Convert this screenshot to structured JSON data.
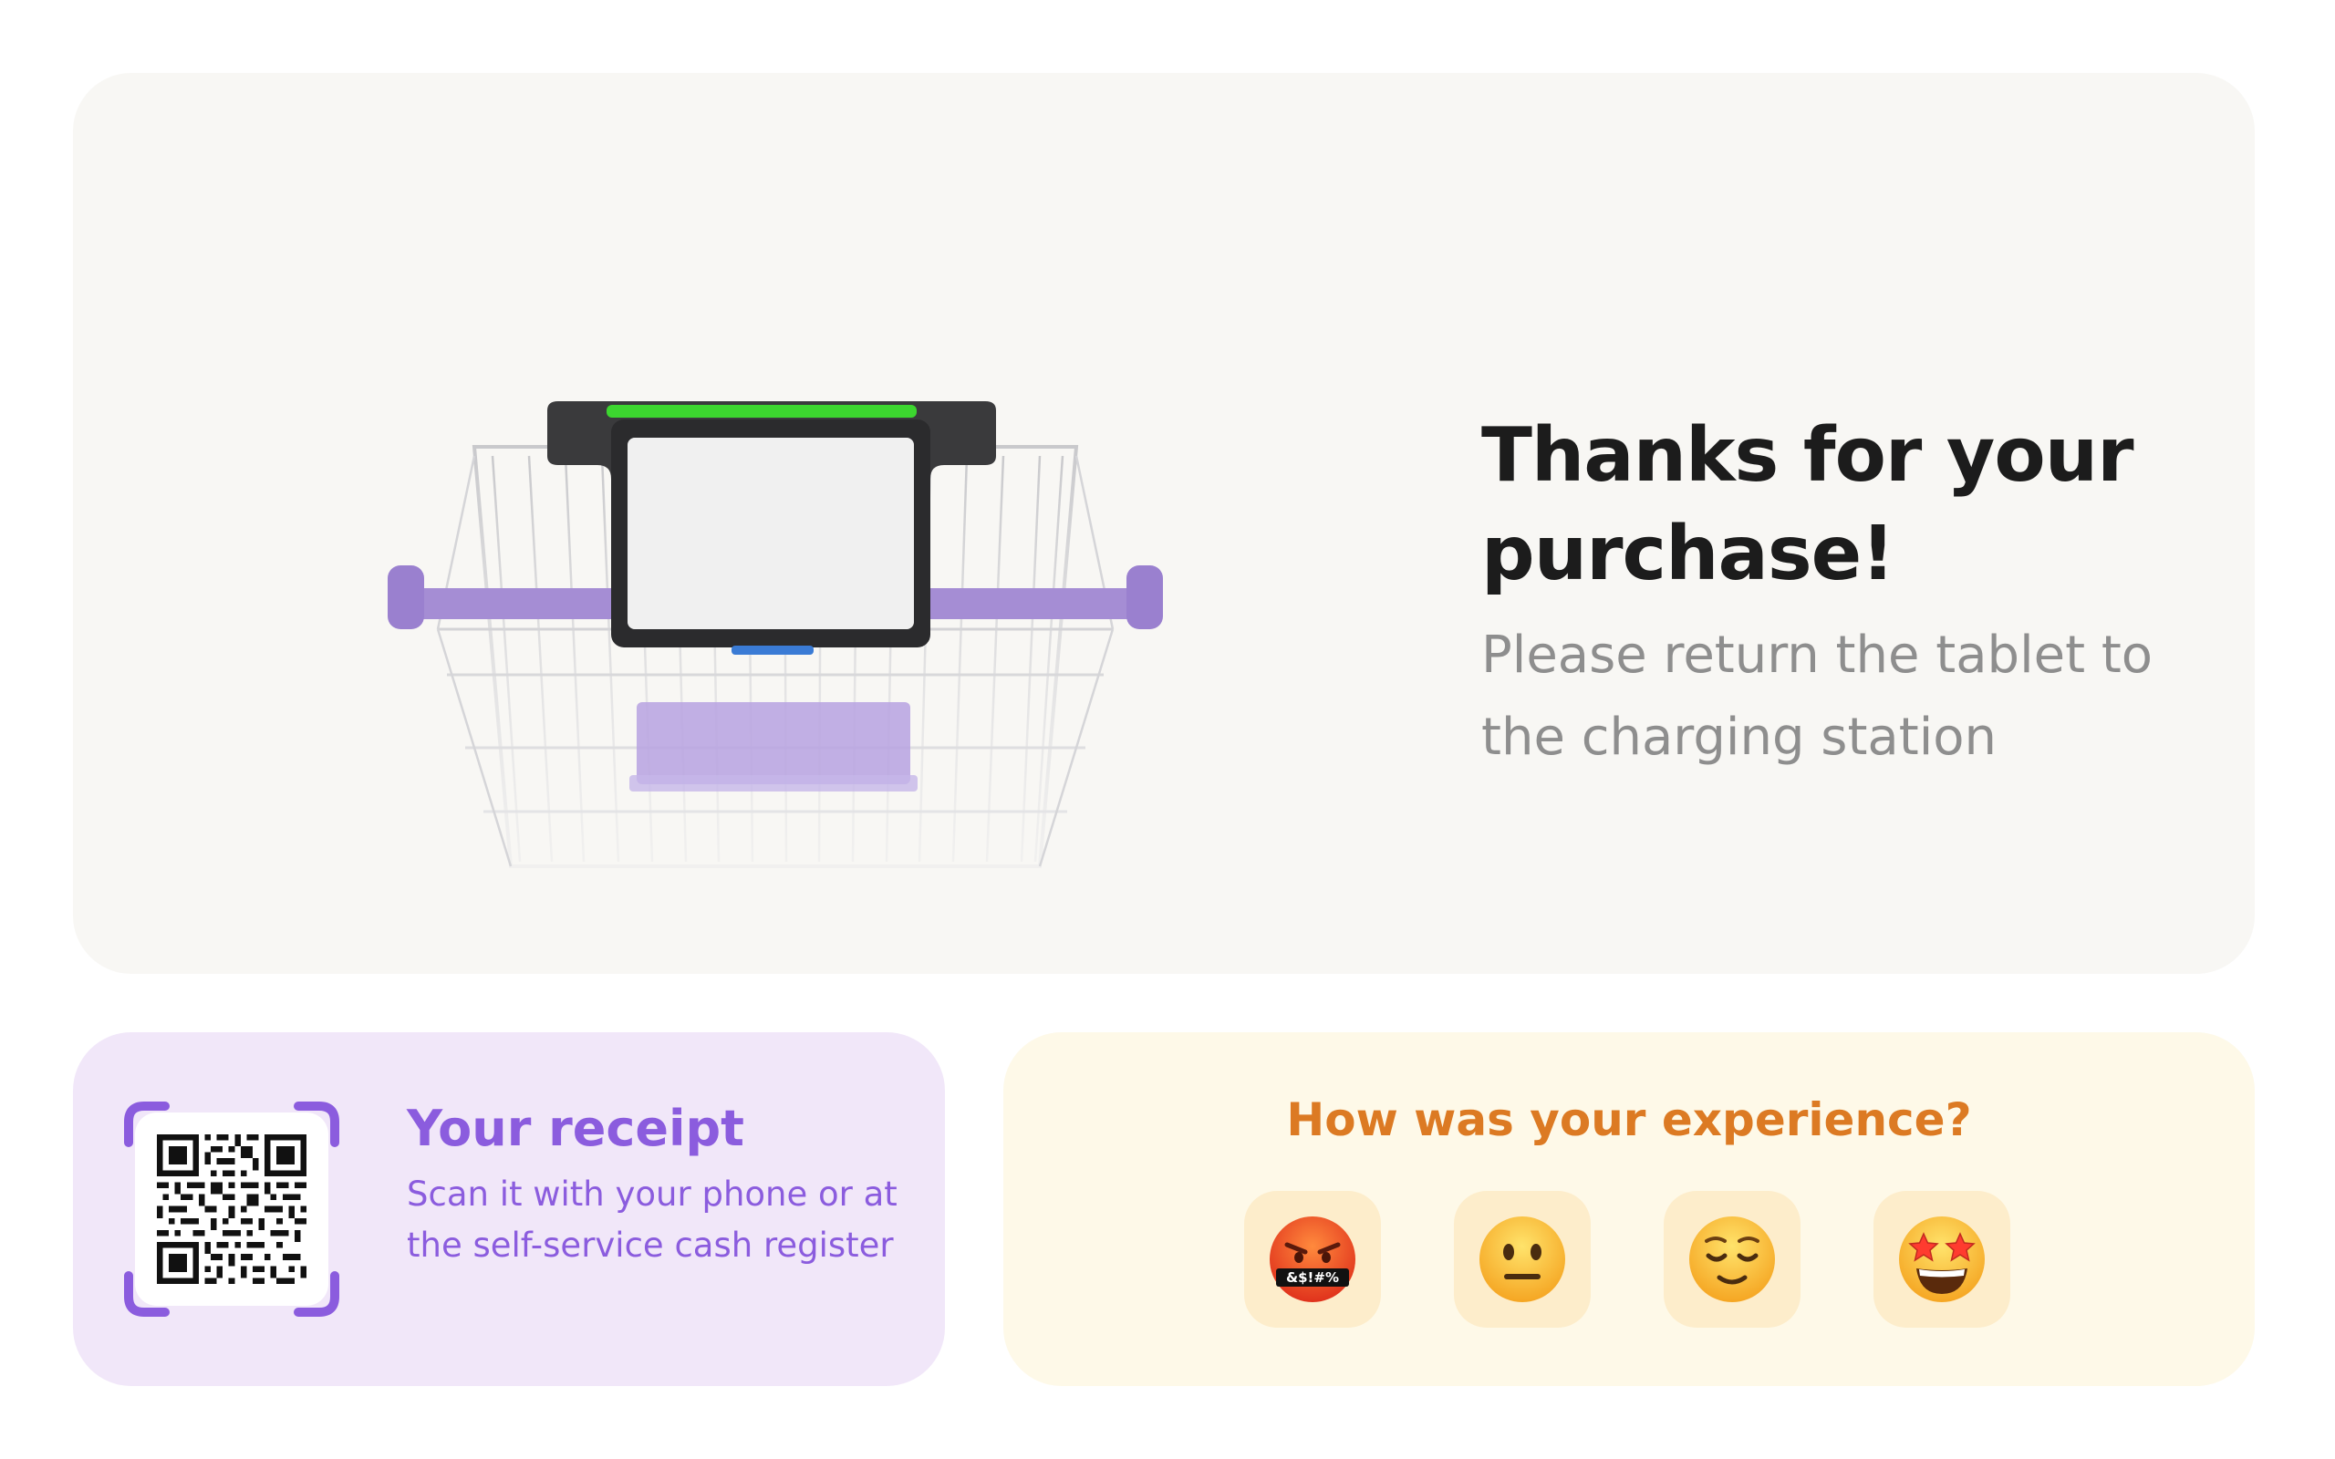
{
  "hero": {
    "title": "Thanks for your purchase!",
    "subtitle": "Please return the tablet to the charging station",
    "illustration": "smart-cart-with-tablet"
  },
  "receipt": {
    "title": "Your receipt",
    "description": "Scan it with your phone or at the self-service cash register",
    "icon": "qr-code-icon"
  },
  "feedback": {
    "question": "How was your experience?",
    "options": [
      {
        "icon": "angry-swearing-face-icon",
        "glyph_text": "&$!#%"
      },
      {
        "icon": "neutral-face-icon"
      },
      {
        "icon": "relieved-face-icon"
      },
      {
        "icon": "star-struck-face-icon"
      }
    ]
  },
  "colors": {
    "hero_background": "#f8f7f4",
    "receipt_background": "#f1e7f9",
    "receipt_accent": "#8b5cde",
    "feedback_background": "#fef9e8",
    "feedback_accent": "#dc7a23",
    "emoji_tile": "#fdedcb",
    "cart_handle": "#a58dd4",
    "tablet_status_bar": "#3cd62f"
  }
}
